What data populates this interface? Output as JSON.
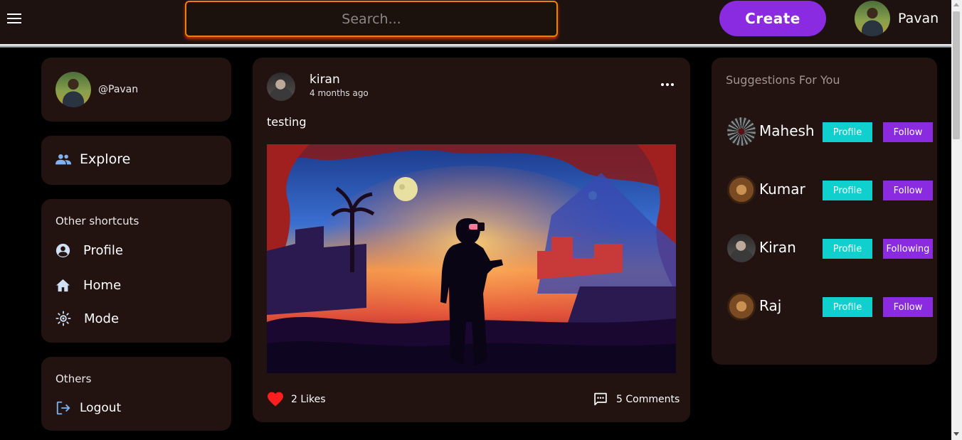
{
  "header": {
    "search_placeholder": "Search...",
    "create_label": "Create",
    "user_name": "Pavan"
  },
  "sidebar": {
    "handle": "@Pavan",
    "explore_label": "Explore",
    "shortcuts_title": "Other shortcuts",
    "shortcuts": [
      {
        "label": "Profile",
        "icon": "account-circle-icon"
      },
      {
        "label": "Home",
        "icon": "home-icon"
      },
      {
        "label": "Mode",
        "icon": "brightness-icon"
      }
    ],
    "others_title": "Others",
    "logout_label": "Logout"
  },
  "post": {
    "author": "kiran",
    "time": "4 months ago",
    "text": "testing",
    "likes": "2 Likes",
    "comments": "5 Comments"
  },
  "suggestions": {
    "title": "Suggestions For You",
    "items": [
      {
        "name": "Mahesh",
        "profile_label": "Profile",
        "follow_label": "Follow"
      },
      {
        "name": "Kumar",
        "profile_label": "Profile",
        "follow_label": "Follow"
      },
      {
        "name": "Kiran",
        "profile_label": "Profile",
        "follow_label": "Following"
      },
      {
        "name": "Raj",
        "profile_label": "Profile",
        "follow_label": "Follow"
      }
    ]
  },
  "colors": {
    "accent_purple": "#8a2be2",
    "profile_cyan": "#10cfcf",
    "card_bg": "#231310",
    "search_border": "#e8820c",
    "like_red": "#ff1f1f"
  }
}
